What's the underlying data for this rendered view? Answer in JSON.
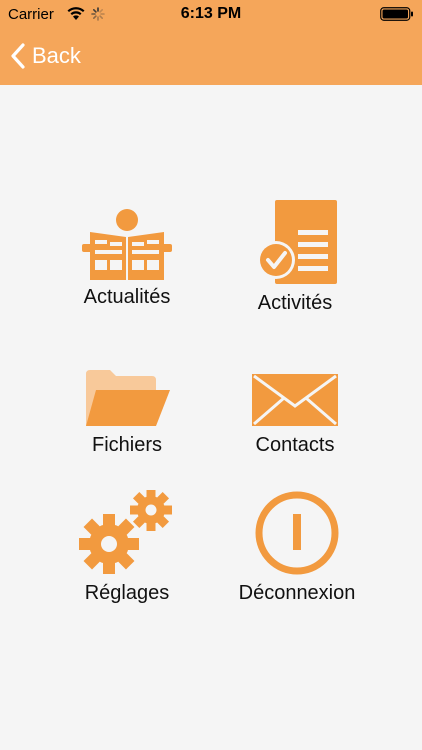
{
  "status_bar": {
    "carrier": "Carrier",
    "time": "6:13 PM",
    "icons": [
      "wifi-icon",
      "activity-indicator-icon",
      "battery-icon"
    ]
  },
  "nav": {
    "back_label": "Back"
  },
  "menu": {
    "items": [
      {
        "label": "Actualités",
        "icon": "newspaper-reader-icon"
      },
      {
        "label": "Activités",
        "icon": "document-check-icon"
      },
      {
        "label": "Fichiers",
        "icon": "folder-icon"
      },
      {
        "label": "Contacts",
        "icon": "envelope-icon"
      },
      {
        "label": "Réglages",
        "icon": "gears-icon"
      },
      {
        "label": "Déconnexion",
        "icon": "power-icon"
      }
    ]
  },
  "colors": {
    "header": "#f5a65a",
    "accent": "#f29a3f",
    "background": "#f5f5f5"
  }
}
